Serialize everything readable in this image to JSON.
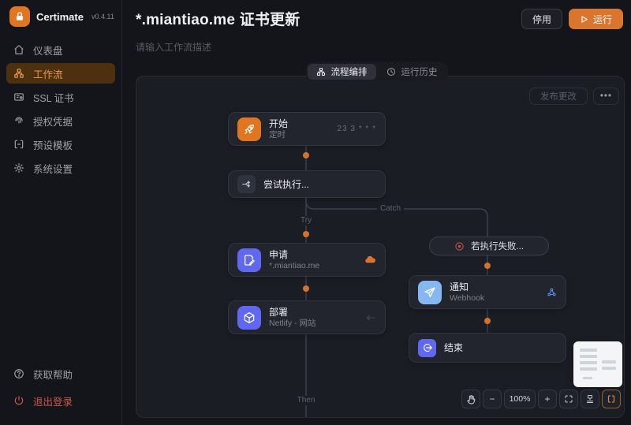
{
  "app": {
    "brand": "Certimate",
    "version": "v0.4.11"
  },
  "sidebar": {
    "items": [
      {
        "label": "仪表盘"
      },
      {
        "label": "工作流"
      },
      {
        "label": "SSL 证书"
      },
      {
        "label": "授权凭据"
      },
      {
        "label": "预设模板"
      },
      {
        "label": "系统设置"
      }
    ],
    "footer": [
      {
        "label": "获取帮助"
      },
      {
        "label": "退出登录"
      }
    ]
  },
  "header": {
    "title": "*.miantiao.me 证书更新",
    "description_placeholder": "请输入工作流描述",
    "disable_button": "停用",
    "run_button": "运行"
  },
  "tabs": {
    "editor": "流程编排",
    "history": "运行历史"
  },
  "canvas": {
    "publish_button": "发布更改",
    "more_button": "•••",
    "edge_labels": {
      "try": "Try",
      "catch": "Catch",
      "then": "Then"
    },
    "nodes": {
      "start": {
        "title": "开始",
        "subtitle": "定时",
        "meta": "23 3 * * *"
      },
      "try_block": {
        "title": "尝试执行..."
      },
      "apply": {
        "title": "申请",
        "subtitle": "*.miantiao.me"
      },
      "deploy": {
        "title": "部署",
        "subtitle": "Netlify - 网站"
      },
      "catch_block": {
        "title": "若执行失败..."
      },
      "notify": {
        "title": "通知",
        "subtitle": "Webhook"
      },
      "end": {
        "title": "结束"
      }
    },
    "toolbar": {
      "zoom_out": "−",
      "zoom_level": "100%",
      "zoom_in": "+"
    }
  },
  "colors": {
    "accent": "#d9752d",
    "sidebar_active_text": "#e5984f",
    "danger": "#c9594a",
    "node_orange": "#e0761f",
    "node_indigo": "#6168f0",
    "node_blue": "#85b8f0",
    "fail_red": "#c4524c",
    "edge_dot": "#d2722f"
  }
}
